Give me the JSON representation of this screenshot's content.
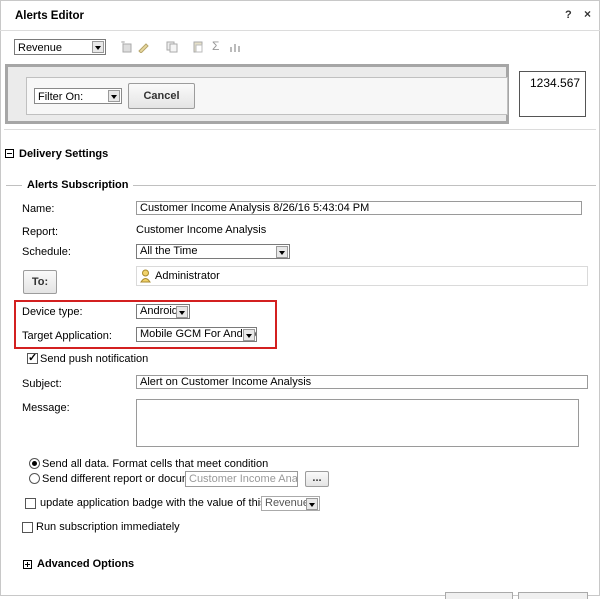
{
  "window": {
    "title": "Alerts Editor",
    "help": "?",
    "close": "×"
  },
  "toolbar": {
    "metric_select": "Revenue",
    "icons": [
      "insert-icon",
      "edit-icon",
      "copy-icon",
      "paste-icon",
      "sigma-icon",
      "chart-icon"
    ],
    "sigma": "Σ"
  },
  "filter": {
    "select": "Filter On:",
    "cancel": "Cancel",
    "value_display": "1234.567"
  },
  "delivery": {
    "title": "Delivery Settings"
  },
  "subscription": {
    "title": "Alerts Subscription",
    "name_label": "Name:",
    "name_value": "Customer Income Analysis 8/26/16 5:43:04 PM",
    "report_label": "Report:",
    "report_value": "Customer Income Analysis",
    "schedule_label": "Schedule:",
    "schedule_value": "All the Time",
    "to_button": "To:",
    "recipient": "Administrator",
    "device_type_label": "Device type:",
    "device_type_value": "Android",
    "target_app_label": "Target Application:",
    "target_app_value": "Mobile GCM For Android",
    "push_label": "Send push notification",
    "push_checked": true,
    "subject_label": "Subject:",
    "subject_value": "Alert on Customer Income Analysis",
    "message_label": "Message:",
    "message_value": "",
    "send_all_label": "Send all data. Format cells that meet condition",
    "send_diff_label": "Send different report or document",
    "send_diff_placeholder": "Customer Income Analysis",
    "browse": "...",
    "badge_label": "update application badge with the value of this metric",
    "badge_metric": "Revenue",
    "run_immediately_label": "Run subscription immediately"
  },
  "advanced": {
    "title": "Advanced Options"
  }
}
